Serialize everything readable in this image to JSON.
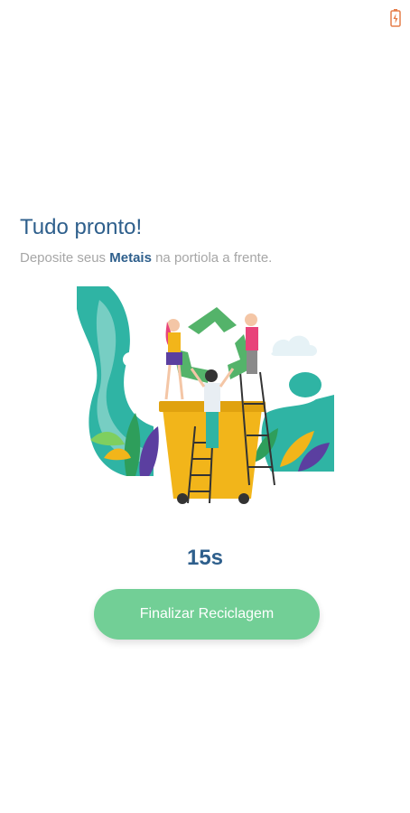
{
  "status_bar": {
    "battery_icon": "battery-charging-icon"
  },
  "header": {
    "title": "Tudo pronto!",
    "subtitle_prefix": "Deposite seus ",
    "subtitle_material": "Metais",
    "subtitle_suffix": " na portiola a frente."
  },
  "illustration": {
    "icon": "recycling-illustration"
  },
  "timer": {
    "value": "15s"
  },
  "actions": {
    "finish_label": "Finalizar Reciclagem"
  },
  "colors": {
    "title": "#2e5f8c",
    "subtitle": "#a6a6a6",
    "button": "#72cf96",
    "teal": "#2fb4a4",
    "bin": "#f2b51a",
    "recycle_green": "#54b36a"
  }
}
